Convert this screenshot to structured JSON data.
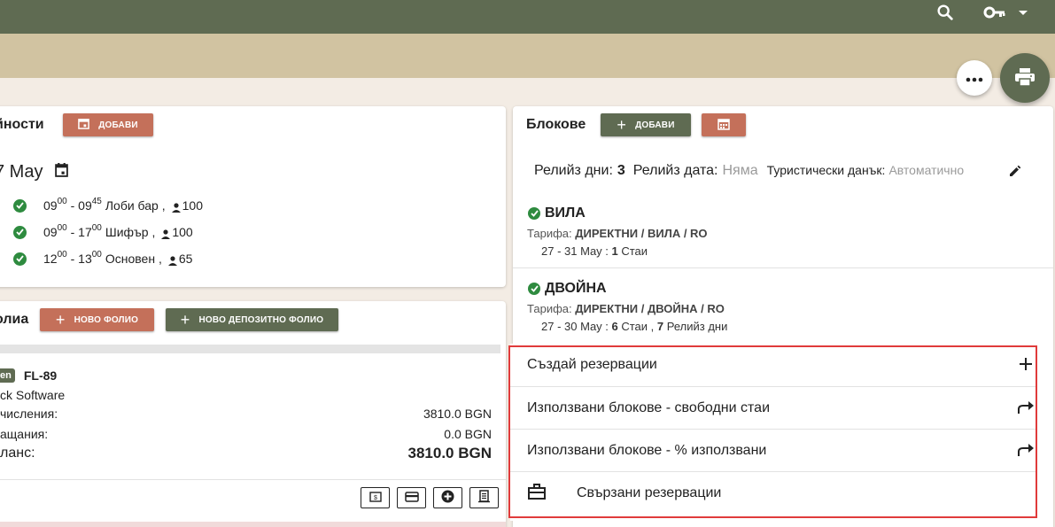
{
  "topbar": {
    "search_icon": "search-icon",
    "key_icon": "key-icon",
    "dropdown_icon": "caret-down-icon"
  },
  "actions": {
    "more_icon": "more-horiz-icon",
    "print_icon": "print-icon"
  },
  "events_card": {
    "title": "йности",
    "add_label": "ДОБАВИ",
    "date": "7 May",
    "events": [
      {
        "start_h": "09",
        "start_m": "00",
        "end_h": "09",
        "end_m": "45",
        "place": "Лоби бар ,",
        "count": "100"
      },
      {
        "start_h": "09",
        "start_m": "00",
        "end_h": "17",
        "end_m": "00",
        "place": "Шифър ,",
        "count": "100"
      },
      {
        "start_h": "12",
        "start_m": "00",
        "end_h": "13",
        "end_m": "00",
        "place": "Основен ,",
        "count": "65"
      }
    ]
  },
  "folio_card": {
    "title": "олиа",
    "new_folio_label": "НОВО ФОЛИО",
    "new_deposit_label": "НОВО ДЕПОЗИТНО ФОЛИО",
    "badge": "en",
    "folio_id": "FL-89",
    "company": "ck Software",
    "rows": [
      {
        "label": "числения:",
        "value": "3810.0 BGN"
      },
      {
        "label": "ащания:",
        "value": "0.0 BGN"
      }
    ],
    "balance_label": "ланс:",
    "balance_value": "3810.0 BGN"
  },
  "blocks_card": {
    "title": "Блокове",
    "add_label": "ДОБАВИ",
    "release_days_label": "Релийз дни:",
    "release_days_value": "3",
    "release_date_label": "Релийз дата:",
    "release_date_value": "Няма",
    "tax_label": "Туристически данък:",
    "tax_value": "Автоматично",
    "blocks": [
      {
        "name": "ВИЛА",
        "rate_label": "Тарифа:",
        "rate": "ДИРЕКТНИ / ВИЛА / RO",
        "dates": "27 - 31 Мау :",
        "rooms": "1",
        "rooms_label": "Стаи",
        "extra_num": "",
        "extra_label": ""
      },
      {
        "name": "ДВОЙНА",
        "rate_label": "Тарифа:",
        "rate": "ДИРЕКТНИ / ДВОЙНА / RO",
        "dates": "27 - 30 Мау :",
        "rooms": "6",
        "rooms_label": "Стаи ,",
        "extra_num": "7",
        "extra_label": "Релийз дни"
      }
    ]
  },
  "context_menu": {
    "items": [
      {
        "label": "Създай резервации",
        "icon": "plus-icon"
      },
      {
        "label": "Използвани блокове - свободни стаи",
        "icon": "forward-icon"
      },
      {
        "label": "Използвани блокове - % използвани",
        "icon": "forward-icon"
      },
      {
        "label": "Свързани резервации",
        "icon": "briefcase-icon"
      }
    ]
  },
  "colors": {
    "topbar": "#5f6b52",
    "subbar": "#d1c3a1",
    "accent_red": "#c4705a",
    "accent_green": "#5f6b52",
    "check_green": "#2e8b3f",
    "highlight": "#e03b3b"
  }
}
